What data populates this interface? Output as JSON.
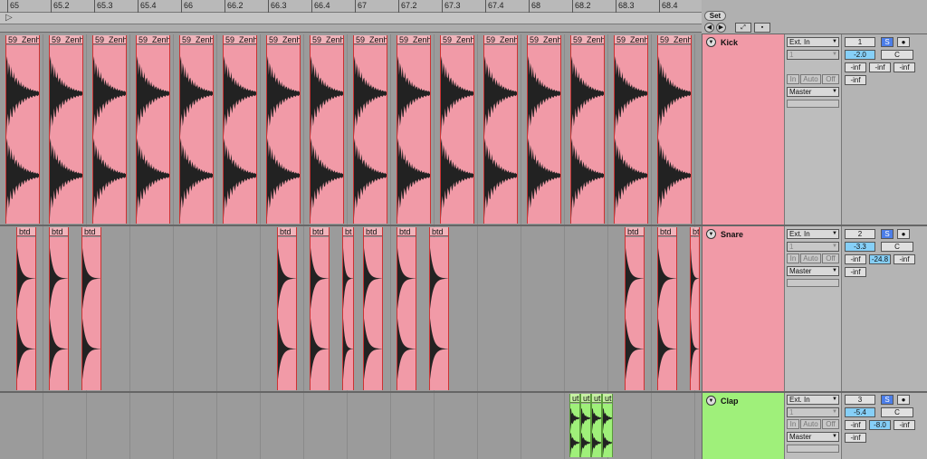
{
  "ruler": {
    "ticks": [
      "65",
      "65.2",
      "65.3",
      "65.4",
      "66",
      "66.2",
      "66.3",
      "66.4",
      "67",
      "67.2",
      "67.3",
      "67.4",
      "68",
      "68.2",
      "68.3",
      "68.4"
    ]
  },
  "controls": {
    "set_label": "Set"
  },
  "tracks": [
    {
      "name": "Kick",
      "input_type": "Ext. In",
      "input_channel": "1",
      "monitor": [
        "In",
        "Auto",
        "Off"
      ],
      "output": "Master",
      "number": "1",
      "solo": "S",
      "volume": "-2.0",
      "pan": "C",
      "sends": [
        "-inf",
        "-inf",
        "-inf"
      ],
      "peak": "-inf",
      "clip_label": "59_Zenh",
      "clip_count": 16
    },
    {
      "name": "Snare",
      "input_type": "Ext. In",
      "input_channel": "1",
      "monitor": [
        "In",
        "Auto",
        "Off"
      ],
      "output": "Master",
      "number": "2",
      "solo": "S",
      "volume": "-3.3",
      "pan": "C",
      "sends": [
        "-inf",
        "-24.8",
        "-inf"
      ],
      "peak": "-inf",
      "clip_labels": [
        "btd",
        "btd",
        "btd",
        "btd",
        "btd",
        "bt",
        "btd",
        "btd",
        "btd",
        "btd",
        "btd",
        "btd"
      ]
    },
    {
      "name": "Clap",
      "input_type": "Ext. In",
      "input_channel": "1",
      "monitor": [
        "In",
        "Auto",
        "Off"
      ],
      "output": "Master",
      "number": "3",
      "solo": "S",
      "volume": "-5.4",
      "pan": "C",
      "sends": [
        "-inf",
        "-8.0",
        "-inf"
      ],
      "peak": "-inf",
      "clip_labels": [
        "ut",
        "ut",
        "ut",
        "ut"
      ]
    }
  ],
  "colors": {
    "kick": "#f19aa7",
    "snare": "#f19aa7",
    "clap": "#9ff07a",
    "solo": "#4c7ee8",
    "volume": "#86cff7"
  }
}
